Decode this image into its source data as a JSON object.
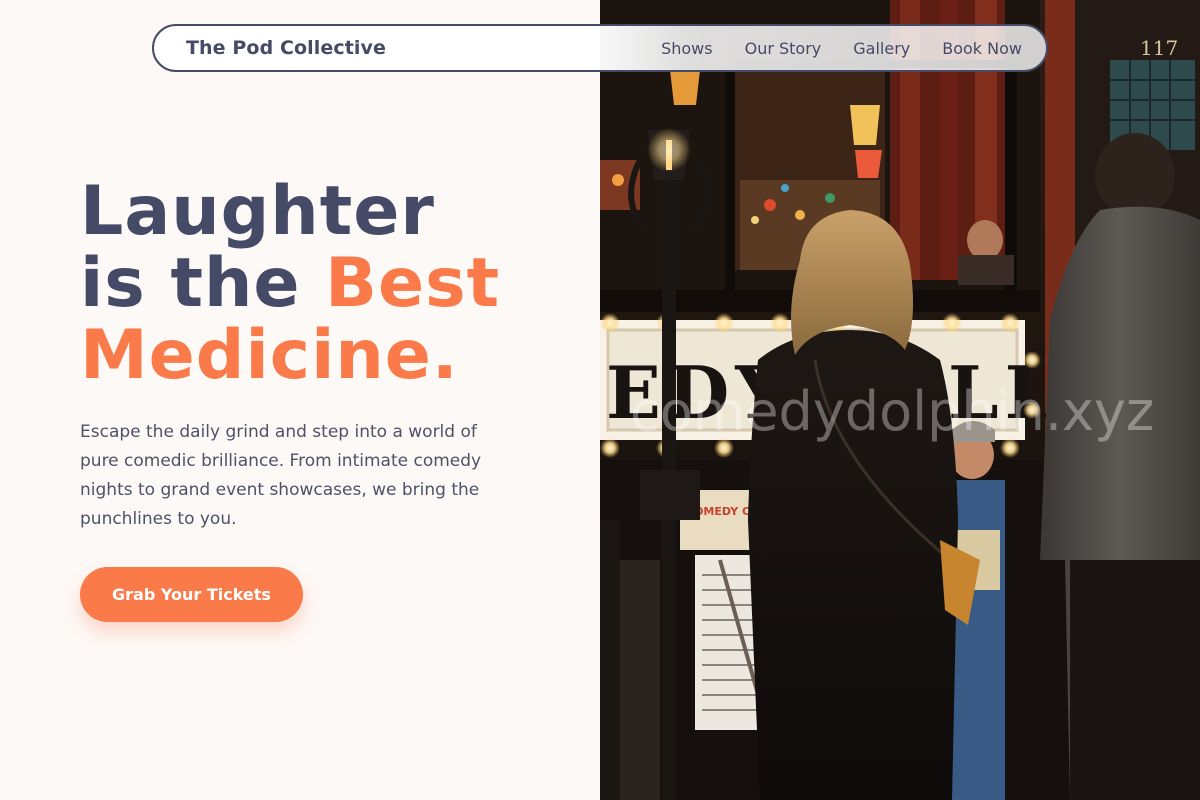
{
  "nav": {
    "brand": "The Pod Collective",
    "links": [
      {
        "label": "Shows"
      },
      {
        "label": "Our Story"
      },
      {
        "label": "Gallery"
      },
      {
        "label": "Book Now"
      }
    ]
  },
  "hero": {
    "headline_line1": "Laughter",
    "headline_line2_plain": "is the ",
    "headline_line2_accent": "Best",
    "headline_line3_accent": "Medicine.",
    "intro": "Escape the daily grind and step into a world of pure comedic brilliance. From intimate comedy nights to grand event showcases, we bring the punchlines to you.",
    "cta_label": "Grab Your Tickets"
  },
  "image": {
    "sign_text": "EDY CELLAR",
    "door_number": "117",
    "poster_text": "COMEDY CELLAR",
    "watermark": "comedydolphin.xyz"
  },
  "colors": {
    "navy": "#454a67",
    "accent": "#fb7a4a",
    "background": "#fdf9f7",
    "body_text": "#4d5266"
  }
}
